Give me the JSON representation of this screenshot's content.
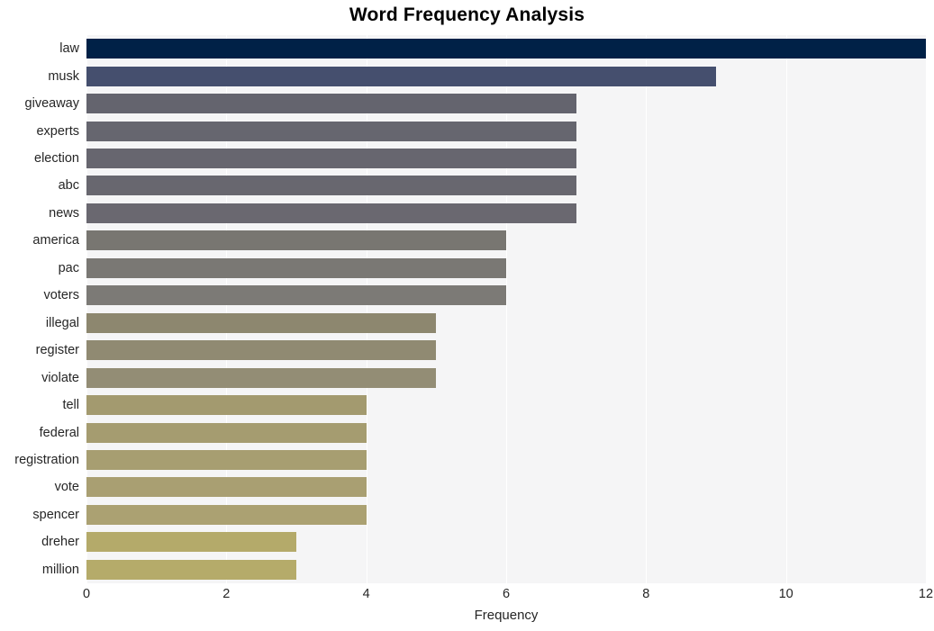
{
  "chart_data": {
    "type": "bar",
    "orientation": "horizontal",
    "title": "Word Frequency Analysis",
    "xlabel": "Frequency",
    "ylabel": "",
    "xlim": [
      0,
      12
    ],
    "xticks": [
      "0",
      "2",
      "4",
      "6",
      "8",
      "10",
      "12"
    ],
    "xtick_values": [
      0,
      2,
      4,
      6,
      8,
      10,
      12
    ],
    "grid": "vertical-white",
    "legend": "none",
    "plot_background": "#f5f5f6",
    "categories": [
      "law",
      "musk",
      "giveaway",
      "experts",
      "election",
      "abc",
      "news",
      "america",
      "pac",
      "voters",
      "illegal",
      "register",
      "violate",
      "tell",
      "federal",
      "registration",
      "vote",
      "spencer",
      "dreher",
      "million"
    ],
    "values": [
      12,
      9,
      7,
      7,
      7,
      7,
      7,
      6,
      6,
      6,
      5,
      5,
      5,
      4,
      4,
      4,
      4,
      4,
      3,
      3
    ],
    "bar_colors": [
      "#002147",
      "#454f6e",
      "#64646e",
      "#66666f",
      "#67666f",
      "#68676f",
      "#6a6870",
      "#787671",
      "#7a7874",
      "#7c7a76",
      "#8d876f",
      "#908a72",
      "#938d75",
      "#a39a6f",
      "#a59c70",
      "#a79e71",
      "#a99f72",
      "#aba172",
      "#b4aa6a",
      "#b5ab6a"
    ]
  }
}
